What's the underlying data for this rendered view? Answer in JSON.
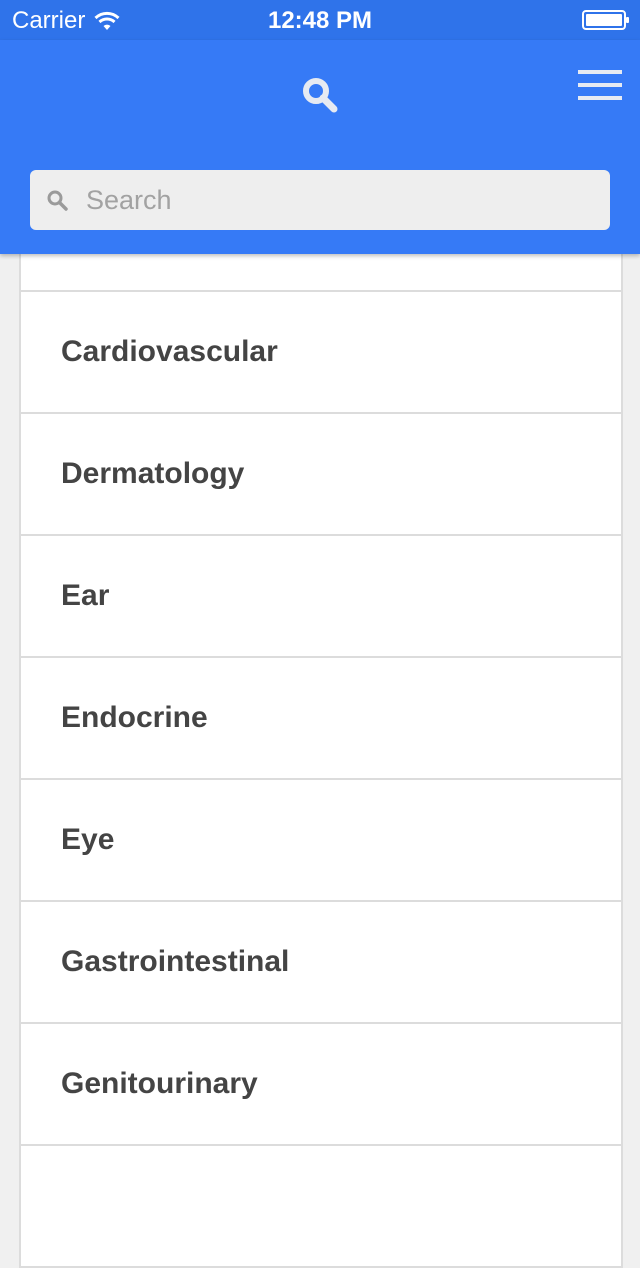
{
  "status_bar": {
    "carrier": "Carrier",
    "time": "12:48 PM"
  },
  "header": {
    "search_icon": "search-icon",
    "menu_icon": "hamburger-menu-icon"
  },
  "search": {
    "placeholder": "Search",
    "value": ""
  },
  "categories": [
    "",
    "Cardiovascular",
    "Dermatology",
    "Ear",
    "Endocrine",
    "Eye",
    "Gastrointestinal",
    "Genitourinary",
    ""
  ],
  "colors": {
    "header": "#367af6",
    "status_bar": "#2f73ea",
    "item_text": "#444444",
    "divider": "#dcdcdc"
  }
}
